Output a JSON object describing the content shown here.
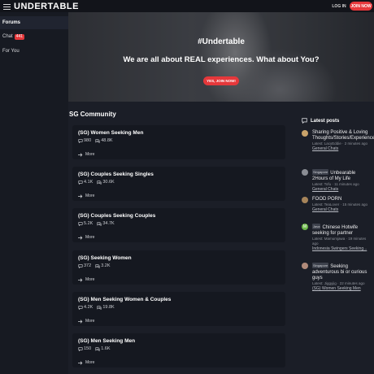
{
  "header": {
    "brand": "UNDERTABLE",
    "login_label": "LOG IN",
    "join_label": "JOIN NOW"
  },
  "sidebar": {
    "items": [
      {
        "label": "Forums"
      },
      {
        "label": "Chat",
        "badge": "441"
      },
      {
        "label": "For You"
      }
    ]
  },
  "hero": {
    "title": "#Undertable",
    "subtitle": "We are all about REAL experiences. What about You?",
    "button": "YES, JOIN NOW!"
  },
  "community": {
    "title": "SG Community",
    "more_label": "More",
    "forums": [
      {
        "title": "(SG) Women Seeking Men",
        "threads": "980",
        "messages": "48.8K"
      },
      {
        "title": "(SG) Couples Seeking Singles",
        "threads": "4.1K",
        "messages": "30.6K"
      },
      {
        "title": "(SG) Couples Seeking Couples",
        "threads": "5.2K",
        "messages": "34.7K"
      },
      {
        "title": "(SG) Seeking Women",
        "threads": "372",
        "messages": "3.2K"
      },
      {
        "title": "(SG) Men Seeking Women & Couples",
        "threads": "4.2K",
        "messages": "19.8K"
      },
      {
        "title": "(SG) Men Seeking Men",
        "threads": "150",
        "messages": "1.6K"
      }
    ]
  },
  "latest": {
    "title": "Latest posts",
    "posts": [
      {
        "title": "Sharing Positive & Loving Thoughts/Stories/Experiences",
        "tag": "",
        "meta": "Latest: LacyEddie · 2 minutes ago",
        "forum": "General Chats",
        "avatar_color": "#c9a36a"
      },
      {
        "title": "Unbearable 2Hours of My Life",
        "tag": "Singapore",
        "meta": "Latest: Tofu · 11 minutes ago",
        "forum": "General Chats",
        "avatar_color": "#8a8d94"
      },
      {
        "title": "FOOD PORN",
        "tag": "",
        "meta": "Latest: TeaLover · 15 minutes ago",
        "forum": "General Chats",
        "avatar_color": "#a6845a"
      },
      {
        "title": "Chinese Hotwife seeking for partner",
        "tag": "Java",
        "meta": "Latest: Mamumjawa · 19 minutes ago",
        "forum": "Indonesia Swingers Seeking...",
        "avatar_color": "#6db84a",
        "avatar_letter": "M"
      },
      {
        "title": "Seeking adventurous bi or curious guys",
        "tag": "Singapore",
        "meta": "Latest: Jiggyjig · 22 minutes ago",
        "forum": "(SG) Women Seeking Men",
        "avatar_color": "#b08a7a"
      }
    ]
  },
  "colors": {
    "accent": "#e5383b",
    "background": "#1b1e27",
    "card": "#151820"
  }
}
